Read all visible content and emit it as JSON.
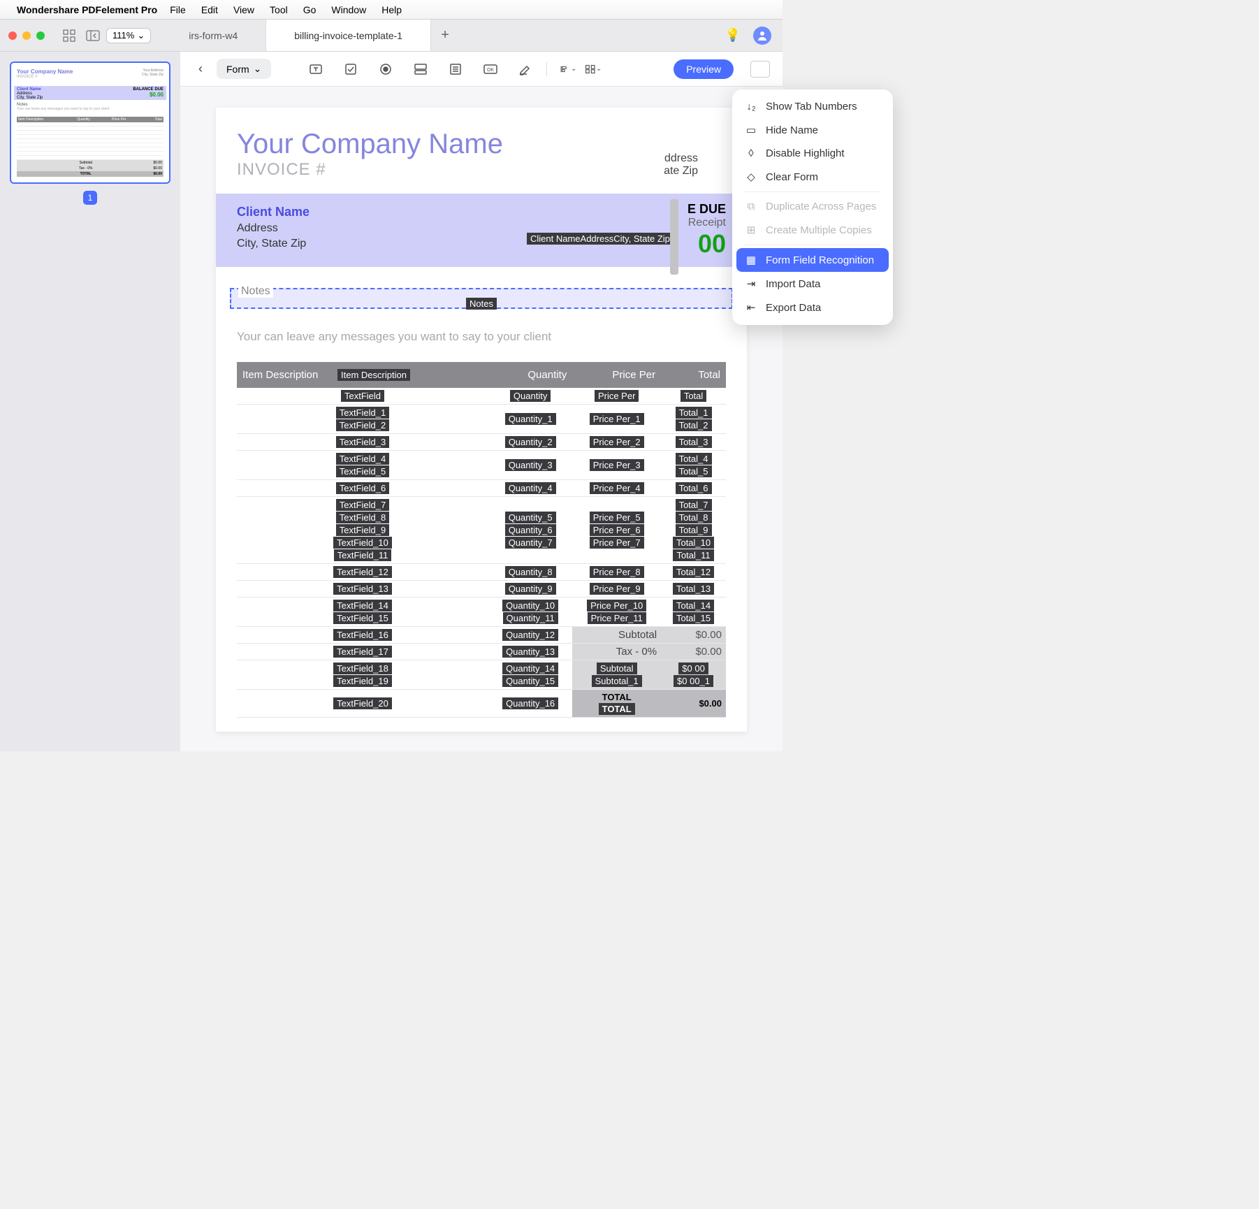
{
  "menubar": {
    "app_name": "Wondershare PDFelement Pro",
    "items": [
      "File",
      "Edit",
      "View",
      "Tool",
      "Go",
      "Window",
      "Help"
    ]
  },
  "titlebar": {
    "zoom": "111%",
    "tabs": [
      {
        "label": "irs-form-w4",
        "active": false
      },
      {
        "label": "billing-invoice-template-1",
        "active": true
      }
    ]
  },
  "toolbar": {
    "form_label": "Form",
    "preview": "Preview"
  },
  "dropdown": {
    "items": [
      {
        "label": "Show Tab Numbers",
        "icon": "list-num",
        "state": "normal"
      },
      {
        "label": "Hide Name",
        "icon": "tag",
        "state": "normal"
      },
      {
        "label": "Disable Highlight",
        "icon": "highlight",
        "state": "normal"
      },
      {
        "label": "Clear Form",
        "icon": "eraser",
        "state": "normal"
      },
      {
        "sep": true
      },
      {
        "label": "Duplicate Across Pages",
        "icon": "dup",
        "state": "disabled"
      },
      {
        "label": "Create Multiple Copies",
        "icon": "plus",
        "state": "disabled"
      },
      {
        "sep": true
      },
      {
        "label": "Form Field Recognition",
        "icon": "recog",
        "state": "selected"
      },
      {
        "label": "Import Data",
        "icon": "import",
        "state": "normal"
      },
      {
        "label": "Export Data",
        "icon": "export",
        "state": "normal"
      }
    ]
  },
  "thumb": {
    "page_number": "1",
    "company": "Your Company Name",
    "invoice": "INVOICE #",
    "balance": "$0.00"
  },
  "page": {
    "company": "Your Company Name",
    "invoice_label": "INVOICE #",
    "your_address": "ddress",
    "your_city": "ate Zip",
    "client_name": "Client Name",
    "client_addr": "Address",
    "client_city": "City, State Zip",
    "client_field": "Client NameAddressCity, State Zip",
    "balance_due_lbl": "E DUE",
    "receipt": "Receipt",
    "amount": "00",
    "notes_label": "Notes",
    "notes_field": "Notes",
    "notes_msg": "Your can leave any messages you want to say to your client",
    "th": {
      "desc": "Item Description",
      "desc_fld": "Item Description",
      "qty": "Quantity",
      "price": "Price Per",
      "total": "Total"
    }
  },
  "rows": [
    {
      "t": [
        "TextField"
      ],
      "q": [
        "Quantity"
      ],
      "p": [
        "Price Per"
      ],
      "tot": [
        "Total"
      ]
    },
    {
      "t": [
        "TextField_1",
        "TextField_2"
      ],
      "q": [
        "Quantity_1"
      ],
      "p": [
        "Price Per_1"
      ],
      "tot": [
        "Total_1",
        "Total_2"
      ]
    },
    {
      "t": [
        "TextField_3"
      ],
      "q": [
        "Quantity_2"
      ],
      "p": [
        "Price Per_2"
      ],
      "tot": [
        "Total_3"
      ]
    },
    {
      "t": [
        "TextField_4",
        "TextField_5"
      ],
      "q": [
        "Quantity_3"
      ],
      "p": [
        "Price Per_3"
      ],
      "tot": [
        "Total_4",
        "Total_5"
      ]
    },
    {
      "t": [
        "TextField_6"
      ],
      "q": [
        "Quantity_4"
      ],
      "p": [
        "Price Per_4"
      ],
      "tot": [
        "Total_6"
      ]
    },
    {
      "t": [
        "TextField_7",
        "TextField_8",
        "TextField_9",
        "TextField_10",
        "TextField_11"
      ],
      "q": [
        "Quantity_5",
        "Quantity_6",
        "Quantity_7"
      ],
      "p": [
        "Price Per_5",
        "Price Per_6",
        "Price Per_7"
      ],
      "tot": [
        "Total_7",
        "Total_8",
        "Total_9",
        "Total_10",
        "Total_11"
      ]
    },
    {
      "t": [
        "TextField_12"
      ],
      "q": [
        "Quantity_8"
      ],
      "p": [
        "Price Per_8"
      ],
      "tot": [
        "Total_12"
      ]
    },
    {
      "t": [
        "TextField_13"
      ],
      "q": [
        "Quantity_9"
      ],
      "p": [
        "Price Per_9"
      ],
      "tot": [
        "Total_13"
      ]
    },
    {
      "t": [
        "TextField_14",
        "TextField_15"
      ],
      "q": [
        "Quantity_10",
        "Quantity_11"
      ],
      "p": [
        "Price Per_10",
        "Price Per_11"
      ],
      "tot": [
        "Total_14",
        "Total_15"
      ]
    }
  ],
  "bottom": [
    {
      "t": "TextField_16",
      "q": "Quantity_12",
      "lbl": "Subtotal",
      "val": "$0.00"
    },
    {
      "t": "TextField_17",
      "q": "Quantity_13",
      "lbl": "Tax - 0%",
      "val": "$0.00"
    },
    {
      "t": [
        "TextField_18",
        "TextField_19"
      ],
      "q": [
        "Quantity_14",
        "Quantity_15"
      ],
      "lbl": [
        "Subtotal",
        "Subtotal_1"
      ],
      "val": [
        "$0 00",
        "$0 00_1"
      ]
    },
    {
      "t": "TextField_20",
      "q": "Quantity_16",
      "lbl": [
        "TOTAL",
        "TOTAL"
      ],
      "val": "$0.00"
    }
  ]
}
